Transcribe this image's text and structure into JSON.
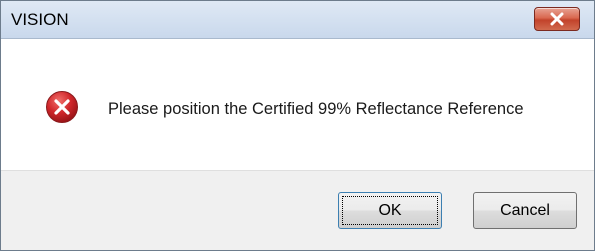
{
  "window": {
    "title": "VISION",
    "close_icon": "close-x-icon",
    "close_color": "#c9452d"
  },
  "message": {
    "icon": "error-icon",
    "icon_color": "#c8262a",
    "text": "Please position the Certified 99% Reflectance Reference"
  },
  "buttons": {
    "ok_label": "OK",
    "cancel_label": "Cancel",
    "default": "OK"
  }
}
